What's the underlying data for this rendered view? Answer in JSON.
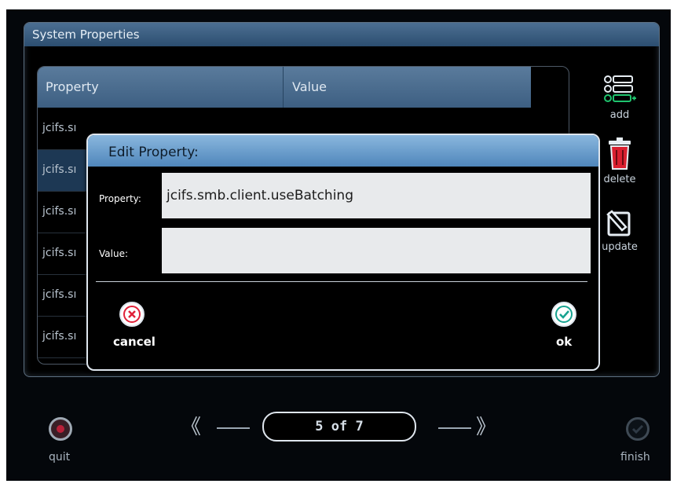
{
  "panel": {
    "title": "System Properties",
    "table": {
      "columns": [
        "Property",
        "Value"
      ],
      "rows": [
        "jcifs.sı",
        "jcifs.sı",
        "jcifs.sı",
        "jcifs.sı",
        "jcifs.sı",
        "jcifs.sı"
      ],
      "selected_row_index": 1
    },
    "side_buttons": {
      "add_label": "add",
      "delete_label": "delete",
      "update_label": "update"
    }
  },
  "nav": {
    "quit_label": "quit",
    "pager": "5 of 7",
    "finish_label": "finish"
  },
  "dialog": {
    "title": "Edit Property:",
    "property_label": "Property:",
    "property_value": "jcifs.smb.client.useBatching",
    "value_label": "Value:",
    "value_value": "",
    "cancel_label": "cancel",
    "ok_label": "ok"
  },
  "colors": {
    "header_blue": "#3d5f82",
    "dialog_header": "#7aaad6",
    "cancel_red": "#e0213a",
    "ok_teal": "#17a290"
  }
}
